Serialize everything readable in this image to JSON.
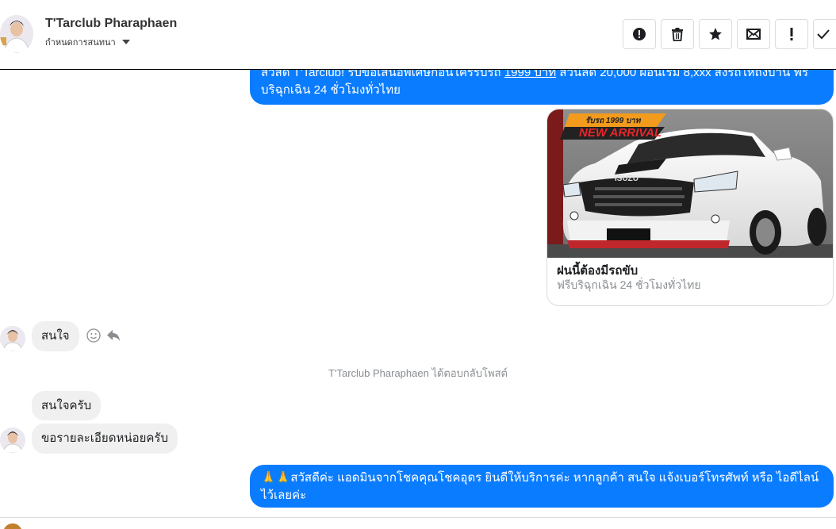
{
  "header": {
    "name": "T'Tarclub Pharaphaen",
    "subtitle": "กำหนดการสนทนา",
    "tools": [
      {
        "name": "report-icon",
        "label": "!"
      },
      {
        "name": "trash-icon",
        "label": ""
      },
      {
        "name": "star-icon",
        "label": ""
      },
      {
        "name": "envelope-icon",
        "label": ""
      },
      {
        "name": "exclamation-icon",
        "label": "!"
      },
      {
        "name": "check-icon",
        "label": ""
      }
    ]
  },
  "messages": {
    "promo_pre": "สวัสดี T'Tarclub! รับข้อเสนอพิเศษก่อนใครรับรถ ",
    "promo_link": "1999 บาท",
    "promo_post": " ส่วนลด 20,000 ผ่อนเริ่ม 8,xxx  ส่งรถให้ถึงบ้าน ฟรี",
    "promo_line2": "บริฉุกเฉิน 24 ชั่วโมงทั่วไทย",
    "card": {
      "banner_top": "รับรถ 1999 บาท",
      "banner_main": "NEW ARRIVAL",
      "title": "ฝนนี้ต้องมีรถขับ",
      "subtitle": "ฟรีบริฉุกเฉิน 24 ชั่วโมงทั่วไทย"
    },
    "interested": "สนใจ",
    "system_reply": "T'Tarclub Pharaphaen ได้ตอบกลับโพสต์",
    "interested_krab": "สนใจครับ",
    "details_request": "ขอรายละเอียดหน่อยครับ",
    "admin_reply_line1": "🙏🙏สวัสดีค่ะ แอดมินจากโชคคุณโชคอุดร ยินดีให้บริการค่ะ หากลูกค้า สนใจ แจ้งเบอร์โทรศัพท์ หรือ ไอดีไลน์",
    "admin_reply_line2": "ไว้เลยค่ะ"
  },
  "colors": {
    "accent": "#0a7cff",
    "incoming_bubble": "#f0f0f0",
    "muted_text": "#8a8d91"
  }
}
